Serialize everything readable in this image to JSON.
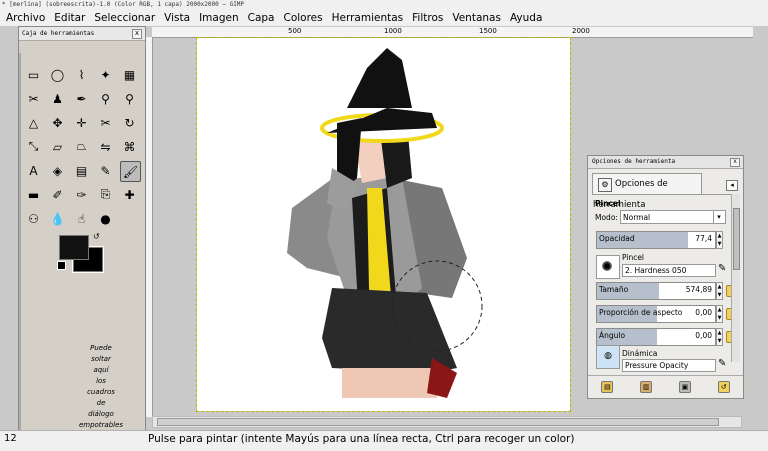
{
  "window": {
    "title": "* [merlina] (sobreescrita)-1.0 (Color RGB, 1 capa) 2000x2000 – GIMP"
  },
  "menubar": {
    "items": [
      "Archivo",
      "Editar",
      "Seleccionar",
      "Vista",
      "Imagen",
      "Capa",
      "Colores",
      "Herramientas",
      "Filtros",
      "Ventanas",
      "Ayuda"
    ]
  },
  "ruler": {
    "ticks": [
      "500",
      "1000",
      "1500",
      "2000"
    ]
  },
  "toolbox": {
    "title": "Caja de herramientas",
    "close": "x",
    "drop_hint": [
      "Puede",
      "soltar",
      "aquí",
      "los",
      "cuadros",
      "de",
      "diálogo",
      "empotrables"
    ],
    "tools": [
      "rect-select",
      "ellipse-select",
      "free-select",
      "fuzzy-select",
      "scissors-select",
      "foreground-select",
      "paths",
      "color-picker",
      "zoom",
      "measure",
      "move",
      "align",
      "crop",
      "rotate",
      "scale",
      "shear",
      "perspective",
      "flip",
      "text",
      "bucket-fill",
      "blend",
      "pencil",
      "paintbrush",
      "eraser",
      "airbrush",
      "ink",
      "clone",
      "heal",
      "smudge",
      "dodge-burn"
    ],
    "active_tool": "paintbrush"
  },
  "options": {
    "title": "Opciones de herramienta",
    "tab_label": "Opciones de herramienta",
    "tool_name": "Pincel",
    "mode_label": "Modo:",
    "mode_value": "Normal",
    "opacity_label": "Opacidad",
    "opacity_value": "77,4",
    "opacity_fraction": 0.774,
    "brush_label": "Pincel",
    "brush_value": "2. Hardness 050",
    "size_label": "Tamaño",
    "size_value": "574,89",
    "aspect_label": "Proporción de aspecto",
    "aspect_value": "0,00",
    "angle_label": "Ángulo",
    "angle_value": "0,00",
    "dynamics_label": "Dinámica",
    "dynamics_value": "Pressure Opacity"
  },
  "statusbar": {
    "zoom": "12",
    "message": "Pulse para pintar (intente Mayús para una línea recta, Ctrl para recoger un color)"
  },
  "colors": {
    "foreground": "#111111",
    "background": "#000000",
    "hat": "#1a1a1a",
    "band": "#f2d81a",
    "jacket": "#808080"
  }
}
